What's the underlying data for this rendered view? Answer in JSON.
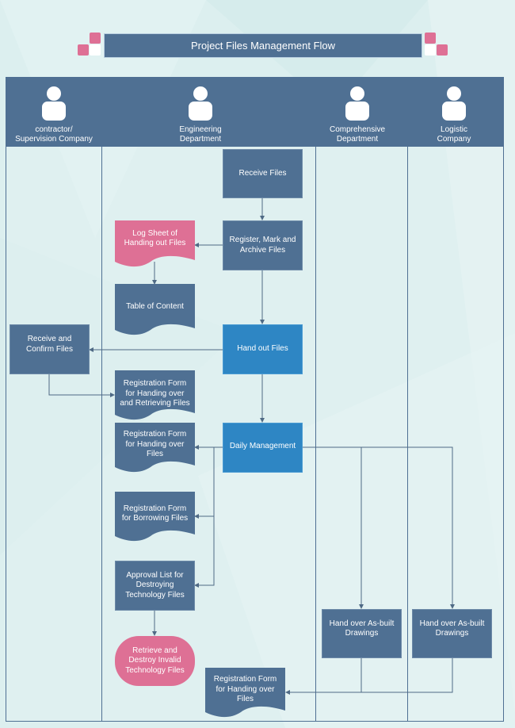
{
  "title": "Project Files Management Flow",
  "colors": {
    "header": "#4f7093",
    "process": "#4f7093",
    "process_highlight": "#2e86c4",
    "document_pink": "#de7095",
    "terminator": "#de7095",
    "connector": "#4f6a85"
  },
  "lanes": [
    {
      "label_line1": "contractor/",
      "label_line2": "Supervision Company",
      "icon": "person-icon"
    },
    {
      "label_line1": "Engineering",
      "label_line2": "Department",
      "icon": "person-icon"
    },
    {
      "label_line1": "Comprehensive",
      "label_line2": "Department",
      "icon": "person-icon"
    },
    {
      "label_line1": "Logistic",
      "label_line2": "Company",
      "icon": "person-icon"
    }
  ],
  "nodes": {
    "receive_files": "Receive Files",
    "register_mark_archive": "Register, Mark and Archive Files",
    "log_sheet": "Log Sheet of Handing out Files",
    "table_of_content": "Table of Content",
    "hand_out_files": "Hand out Files",
    "receive_confirm": "Receive and Confirm Files",
    "reg_form_handing_retrieving": "Registration Form for Handing over and Retrieving Files",
    "daily_management": "Daily Management",
    "reg_form_handing_over": "Registration Form for Handing over Files",
    "reg_form_borrowing": "Registration Form for Borrowing Files",
    "approval_list_destroying": "Approval List for Destroying Technology Files",
    "retrieve_destroy": "Retrieve and Destroy Invalid Technology Files",
    "hand_over_asbuilt_comprehensive": "Hand over As-built Drawings",
    "hand_over_asbuilt_logistic": "Hand over As-built Drawings",
    "reg_form_handing_over_final": "Registration Form for Handing over Files"
  }
}
